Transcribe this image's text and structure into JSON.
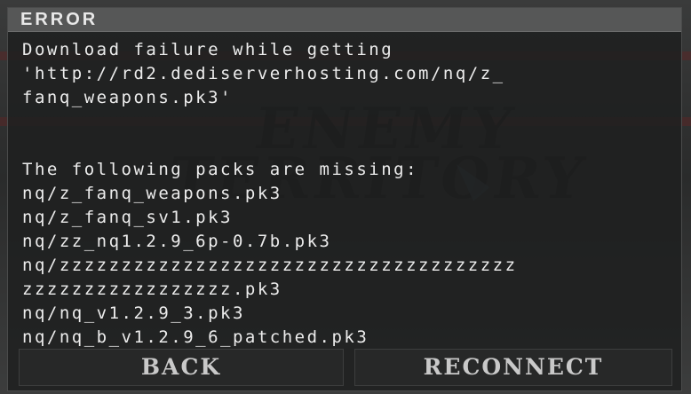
{
  "dialog": {
    "title": "ERROR",
    "lines": [
      "Download failure while getting",
      "'http://rd2.dediserverhosting.com/nq/z_",
      "fanq_weapons.pk3'",
      "",
      "",
      "The following packs are missing:",
      "nq/z_fanq_weapons.pk3",
      "nq/z_fanq_sv1.pk3",
      "nq/zz_nq1.2.9_6p-0.7b.pk3",
      "nq/zzzzzzzzzzzzzzzzzzzzzzzzzzzzzzzzzzzzz",
      "zzzzzzzzzzzzzzzzz.pk3",
      "nq/nq_v1.2.9_3.pk3",
      "nq/nq_b_v1.2.9_6_patched.pk3"
    ],
    "buttons": {
      "back": "BACK",
      "reconnect": "RECONNECT"
    }
  }
}
